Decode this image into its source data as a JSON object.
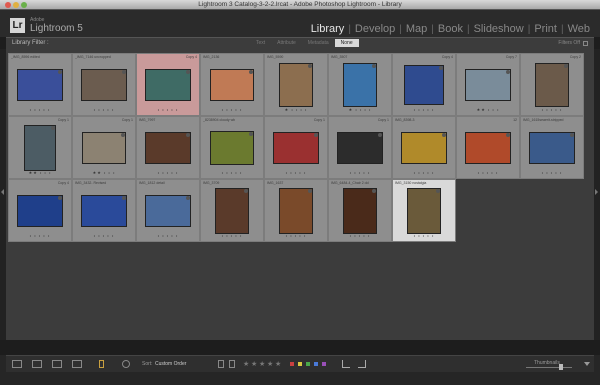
{
  "window": {
    "title": "Lightroom 3 Catalog-3-2-2.lrcat - Adobe Photoshop Lightroom - Library"
  },
  "brand": {
    "logo": "Lr",
    "small": "Adobe",
    "name": "Lightroom 5"
  },
  "modules": [
    "Library",
    "Develop",
    "Map",
    "Book",
    "Slideshow",
    "Print",
    "Web"
  ],
  "active_module": "Library",
  "filter": {
    "title": "Library Filter :",
    "tabs": [
      "Text",
      "Attribute",
      "Metadata",
      "None"
    ],
    "selected": "None",
    "filters_off": "Filters Off"
  },
  "toolbar": {
    "sort_label": "Sort:",
    "sort_value": "Custom Order",
    "thumbnails_label": "Thumbnails"
  },
  "label_colors": [
    "#c94040",
    "#d8c840",
    "#4aa84a",
    "#4a7ad8",
    "#9a50b8"
  ],
  "row1": [
    {
      "name": "_IMG_8596 edited",
      "copy": "",
      "stars": "• • • • •",
      "color": "#3a4f9a",
      "w": 46,
      "h": 32,
      "pink": false
    },
    {
      "name": "_IMG_7146 uncropped",
      "copy": "",
      "stars": "• • • • •",
      "color": "#6b5c4f",
      "w": 46,
      "h": 32,
      "pink": false
    },
    {
      "name": "",
      "copy": "Copy 4",
      "stars": "• • • • •",
      "color": "#3f6b65",
      "w": 46,
      "h": 32,
      "pink": true
    },
    {
      "name": "IMG_2136",
      "copy": "",
      "stars": "• • • • •",
      "color": "#c07a55",
      "w": 44,
      "h": 32,
      "pink": false
    },
    {
      "name": "IMG_5590",
      "copy": "",
      "stars": "★ • • • •",
      "color": "#8c6e4f",
      "w": 34,
      "h": 44,
      "pink": false
    },
    {
      "name": "IMG_3507",
      "copy": "",
      "stars": "★ • • • •",
      "color": "#3a72a8",
      "w": 34,
      "h": 44,
      "pink": false
    },
    {
      "name": "",
      "copy": "Copy 4",
      "stars": "• • • • •",
      "color": "#2f4b8f",
      "w": 40,
      "h": 40,
      "pink": false
    },
    {
      "name": "",
      "copy": "Copy 7",
      "stars": "★★ • • •",
      "color": "#7a8c9a",
      "w": 46,
      "h": 32,
      "pink": false
    },
    {
      "name": "",
      "copy": "Copy 2",
      "stars": "• • • • •",
      "color": "#6b5a4a",
      "w": 34,
      "h": 44,
      "pink": false
    }
  ],
  "row2": [
    {
      "name": "",
      "copy": "Copy 1",
      "stars": "★★ • • •",
      "color": "#4c5c64",
      "w": 32,
      "h": 46,
      "pink": false
    },
    {
      "name": "",
      "copy": "Copy 1",
      "stars": "★★ • • •",
      "color": "#8c8272",
      "w": 44,
      "h": 32,
      "pink": false
    },
    {
      "name": "IMG_7997",
      "copy": "",
      "stars": "• • • • •",
      "color": "#5a3a2a",
      "w": 46,
      "h": 32,
      "pink": false
    },
    {
      "name": "_8238904 cloudy wb",
      "copy": "",
      "stars": "• • • • •",
      "color": "#6b7a2f",
      "w": 44,
      "h": 34,
      "pink": false
    },
    {
      "name": "",
      "copy": "Copy 1",
      "stars": "• • • • •",
      "color": "#9a3030",
      "w": 46,
      "h": 32,
      "pink": false
    },
    {
      "name": "",
      "copy": "Copy 1",
      "stars": "• • • • •",
      "color": "#2c2c2c",
      "w": 46,
      "h": 32,
      "pink": false
    },
    {
      "name": "IMG_8398-3",
      "copy": "",
      "stars": "• • • • •",
      "color": "#b08a2a",
      "w": 46,
      "h": 32,
      "pink": false
    },
    {
      "name": "",
      "copy": "12",
      "stars": "• • • • •",
      "color": "#b04a2a",
      "w": 46,
      "h": 32,
      "pink": false
    },
    {
      "name": "IMG_1615seaerit-stripped",
      "copy": "",
      "stars": "• • • • •",
      "color": "#3a5a8a",
      "w": 46,
      "h": 32,
      "pink": false
    }
  ],
  "row3": [
    {
      "name": "",
      "copy": "Copy 4",
      "stars": "• • • • •",
      "color": "#1f3f8a",
      "w": 46,
      "h": 32,
      "pink": false
    },
    {
      "name": "IMG_3432- Revised",
      "copy": "",
      "stars": "• • • • •",
      "color": "#2a4a9a",
      "w": 46,
      "h": 32,
      "pink": false
    },
    {
      "name": "IMG_1812 detail",
      "copy": "",
      "stars": "• • • • •",
      "color": "#4a6a9a",
      "w": 46,
      "h": 32,
      "pink": false
    },
    {
      "name": "IMG_3709",
      "copy": "",
      "stars": "• • • • •",
      "color": "#5a3a2a",
      "w": 34,
      "h": 46,
      "pink": false
    },
    {
      "name": "IMG_1637",
      "copy": "",
      "stars": "• • • • •",
      "color": "#7a4a2a",
      "w": 34,
      "h": 46,
      "pink": false
    },
    {
      "name": "IMG_6484-4_Chair 2 dd",
      "copy": "",
      "stars": "• • • • •",
      "color": "#4a2a1a",
      "w": 34,
      "h": 46,
      "pink": false
    },
    {
      "name": "IMG_3150 nostalgia",
      "copy": "",
      "stars": "• • • • •",
      "color": "#6a5a3a",
      "w": 34,
      "h": 46,
      "pink": false
    }
  ]
}
